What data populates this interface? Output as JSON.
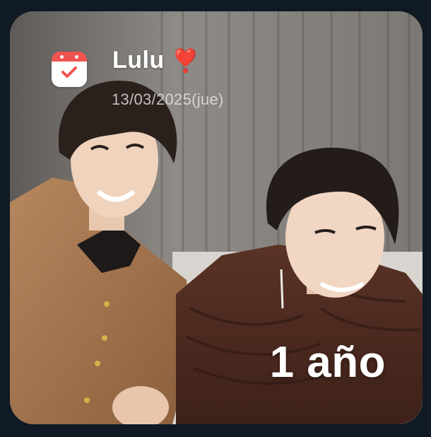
{
  "widget": {
    "title": "Lulu",
    "title_emoji": "❣️",
    "date": "13/03/2025(jue)",
    "duration": "1 año",
    "icon": "calendar-check-icon",
    "colors": {
      "accent": "#ef5350",
      "background": "#0f1a24",
      "text": "#ffffff"
    }
  }
}
